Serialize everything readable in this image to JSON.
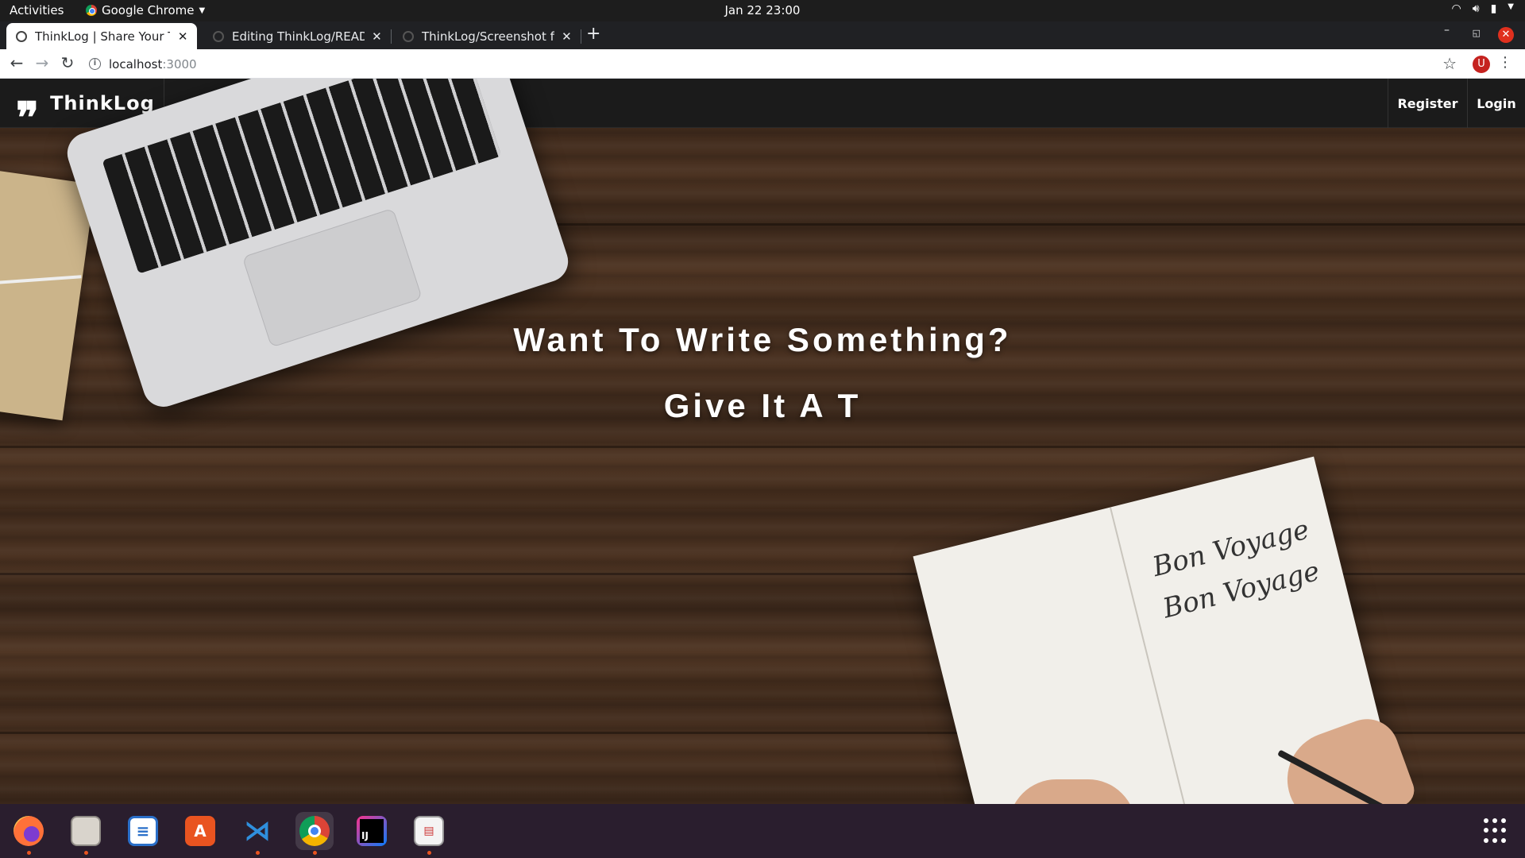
{
  "system": {
    "activities": "Activities",
    "app_name": "Google Chrome",
    "clock": "Jan 22  23:00"
  },
  "tabs": [
    {
      "title": "ThinkLog | Share Your Thoughts",
      "active": true
    },
    {
      "title": "Editing ThinkLog/README.md",
      "active": false
    },
    {
      "title": "ThinkLog/Screenshot from",
      "active": false
    }
  ],
  "toolbar": {
    "url_host": "localhost",
    "url_port": ":3000",
    "profile_initial": "U"
  },
  "site": {
    "brand": "ThinkLog",
    "nav": {
      "register": "Register",
      "login": "Login"
    },
    "hero": {
      "line1": "Want To Write Something?",
      "line2": "Give It A T"
    }
  },
  "decor": {
    "notebook_text": "Bon Voyage"
  },
  "dock": {
    "apps": [
      "firefox-icon",
      "files-icon",
      "writer-icon",
      "software-center-icon",
      "vscode-icon",
      "chrome-icon",
      "intellij-icon",
      "document-viewer-icon"
    ]
  }
}
